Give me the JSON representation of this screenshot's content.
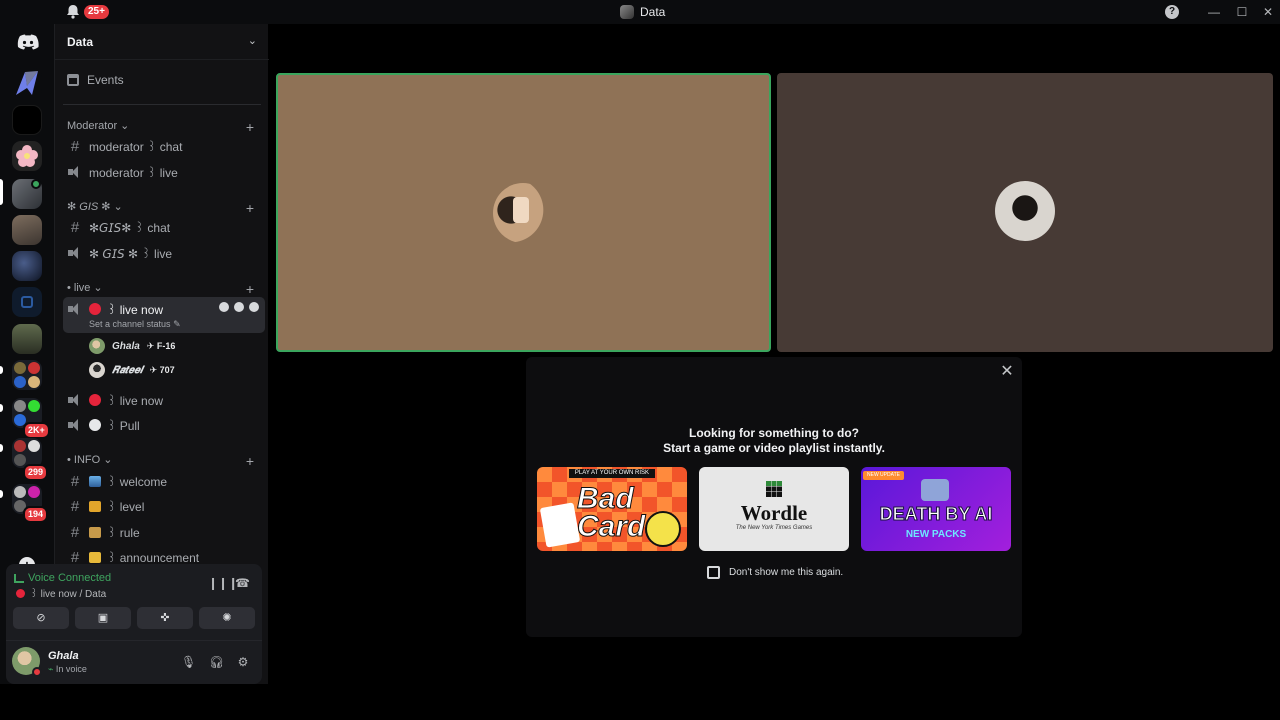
{
  "titlebar": {
    "notification_badge": "25+",
    "window_title": "Data",
    "help_glyph": "?",
    "min_glyph": "—",
    "max_glyph": "☐",
    "close_glyph": "✕"
  },
  "rail": {
    "badges": [
      "2K+",
      "299",
      "194"
    ],
    "add_glyph": "+"
  },
  "sidebar": {
    "server_name": "Data",
    "events_label": "Events",
    "categories": [
      {
        "label": "Moderator",
        "channels": [
          {
            "type": "text",
            "name": "moderator ꒱ chat"
          },
          {
            "type": "voice",
            "name": "moderator ꒱ live"
          }
        ]
      },
      {
        "label": "✻ GIS ✻",
        "channels": [
          {
            "type": "text",
            "name": "✻𝘎𝘐𝘚✻ ꒱ chat"
          },
          {
            "type": "voice",
            "name": "✻ 𝘎𝘐𝘚 ✻ ꒱ live"
          }
        ]
      },
      {
        "label": "• live",
        "channels": [
          {
            "type": "voice",
            "name": "꒱ live now",
            "status": "Set a channel status"
          },
          {
            "type": "voice",
            "name": "꒱ live now"
          },
          {
            "type": "voice",
            "name": "꒱ Pull"
          }
        ]
      },
      {
        "label": "• INFO",
        "channels": [
          {
            "type": "text",
            "name": "꒱ welcome"
          },
          {
            "type": "text",
            "name": "꒱ level"
          },
          {
            "type": "text",
            "name": "꒱ rule"
          },
          {
            "type": "text",
            "name": "꒱ announcement"
          }
        ]
      }
    ],
    "voice_members": [
      {
        "name": "Ghala",
        "tag": "F-16"
      },
      {
        "name": "𝑹𝒂𝒕𝒆𝒆𝒍",
        "tag": "707"
      }
    ]
  },
  "panel": {
    "status": "Voice Connected",
    "channel": "꒱ live now / Data",
    "user_name": "Ghala",
    "user_sub": "In voice"
  },
  "modal": {
    "title_line1": "Looking for something to do?",
    "title_line2": "Start a game or video playlist instantly.",
    "close_glyph": "✕",
    "checkbox_label": "Don't show me this again.",
    "cards": {
      "a_strip": "PLAY AT YOUR OWN RISK",
      "a_word": "Bad Cards",
      "b_word": "Wordle",
      "b_by": "The New York Times Games",
      "c_tag": "NEW UPDATE",
      "c_word": "DEATH BY AI",
      "c_word2": "NEW PACKS"
    }
  },
  "colors": {
    "accent_green": "#3ba55d",
    "live_red": "#e5243b",
    "badge_red": "#e63a3f"
  }
}
